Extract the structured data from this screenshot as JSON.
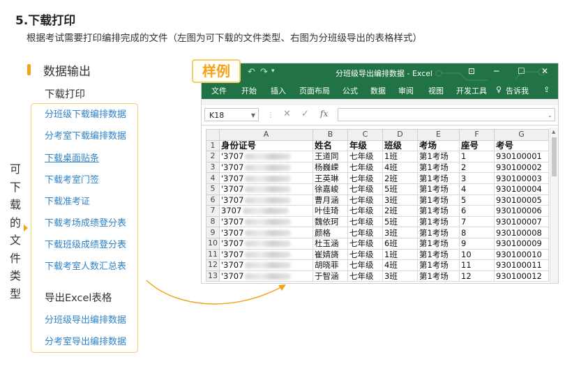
{
  "section": {
    "title": "5.下载打印",
    "description": "根据考试需要打印编排完成的文件（左图为可下载的文件类型、右图为分班级导出的表格样式）"
  },
  "left_panel": {
    "heading": "数据输出",
    "vertical_label": "可下载的文件类型",
    "download_group_label": "下载打印",
    "download_links": [
      {
        "label": "分班级下载编排数据",
        "underlined": false
      },
      {
        "label": "分考室下载编排数据",
        "underlined": false
      },
      {
        "label": "下载桌面贴条",
        "underlined": true
      },
      {
        "label": "下载考室门签",
        "underlined": false
      },
      {
        "label": "下载准考证",
        "underlined": false
      },
      {
        "label": "下载考场成绩登分表",
        "underlined": false
      },
      {
        "label": "下载班级成绩登分表",
        "underlined": false
      },
      {
        "label": "下载考室人数汇总表",
        "underlined": false
      }
    ],
    "export_group_label": "导出Excel表格",
    "export_links": [
      {
        "label": "分班级导出编排数据"
      },
      {
        "label": "分考室导出编排数据"
      }
    ]
  },
  "sample_badge": "样例",
  "excel": {
    "window_title": "分班级导出编排数据  -  Excel",
    "ribbon_tabs": [
      "文件",
      "开始",
      "插入",
      "页面布局",
      "公式",
      "数据",
      "审阅",
      "视图",
      "开发工具"
    ],
    "tell_me": "告诉我",
    "name_box": "K18",
    "column_letters": [
      "A",
      "B",
      "C",
      "D",
      "E",
      "F",
      "G"
    ],
    "table_headers": [
      "身份证号",
      "姓名",
      "年级",
      "班级",
      "考场",
      "座号",
      "考号"
    ],
    "rows": [
      {
        "id_prefix": "'3707",
        "name": "王道同",
        "grade": "七年级",
        "class": "1班",
        "room": "第1考场",
        "seat": "1",
        "exam_no": "930100001"
      },
      {
        "id_prefix": "'3707",
        "name": "杨巍嵘",
        "grade": "七年级",
        "class": "4班",
        "room": "第1考场",
        "seat": "2",
        "exam_no": "930100002"
      },
      {
        "id_prefix": "'3707",
        "name": "王英琳",
        "grade": "七年级",
        "class": "2班",
        "room": "第1考场",
        "seat": "3",
        "exam_no": "930100003"
      },
      {
        "id_prefix": "'3707",
        "name": "徐嘉峻",
        "grade": "七年级",
        "class": "5班",
        "room": "第1考场",
        "seat": "4",
        "exam_no": "930100004"
      },
      {
        "id_prefix": "'3707",
        "name": "曹月涵",
        "grade": "七年级",
        "class": "3班",
        "room": "第1考场",
        "seat": "5",
        "exam_no": "930100005"
      },
      {
        "id_prefix": "3707",
        "name": "叶佳琦",
        "grade": "七年级",
        "class": "2班",
        "room": "第1考场",
        "seat": "6",
        "exam_no": "930100006"
      },
      {
        "id_prefix": "'3707",
        "name": "魏依珂",
        "grade": "七年级",
        "class": "5班",
        "room": "第1考场",
        "seat": "7",
        "exam_no": "930100007"
      },
      {
        "id_prefix": "'3707",
        "name": "颜格",
        "grade": "七年级",
        "class": "3班",
        "room": "第1考场",
        "seat": "8",
        "exam_no": "930100008"
      },
      {
        "id_prefix": "'3707",
        "name": "杜玉涵",
        "grade": "七年级",
        "class": "6班",
        "room": "第1考场",
        "seat": "9",
        "exam_no": "930100009"
      },
      {
        "id_prefix": "'3707",
        "name": "崔婧旖",
        "grade": "七年级",
        "class": "1班",
        "room": "第1考场",
        "seat": "10",
        "exam_no": "930100010"
      },
      {
        "id_prefix": "'3707",
        "name": "胡晓菲",
        "grade": "七年级",
        "class": "4班",
        "room": "第1考场",
        "seat": "11",
        "exam_no": "930100011"
      },
      {
        "id_prefix": "'3707",
        "name": "于智涵",
        "grade": "七年级",
        "class": "3班",
        "room": "第1考场",
        "seat": "12",
        "exam_no": "930100012"
      }
    ]
  },
  "colors": {
    "accent": "#f3a21b",
    "link": "#2f83c9",
    "excel_green": "#217346",
    "box_border": "#f5cd6b"
  }
}
